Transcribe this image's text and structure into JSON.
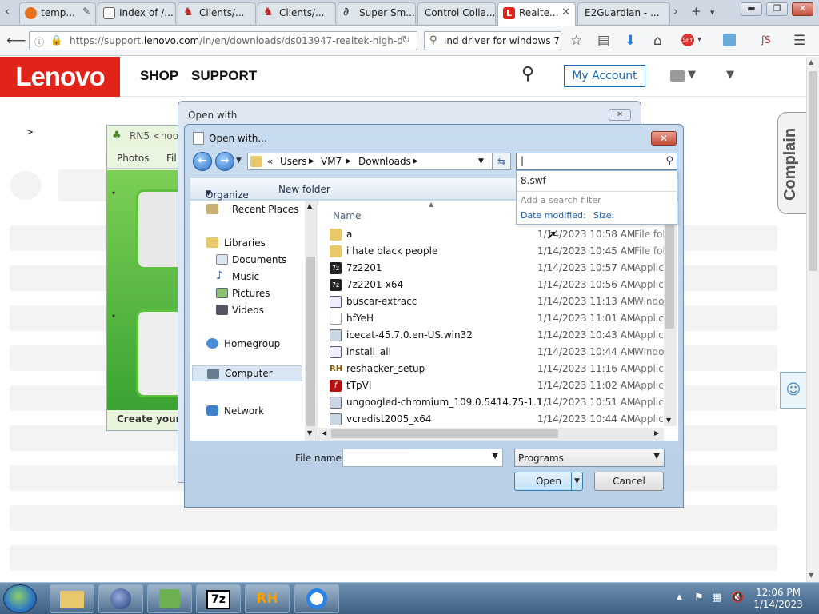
{
  "browser": {
    "tabs": [
      {
        "label": "temp...",
        "active": false
      },
      {
        "label": "Index of /...",
        "active": false
      },
      {
        "label": "Clients/...",
        "active": false
      },
      {
        "label": "Clients/...",
        "active": false
      },
      {
        "label": "Super Sm...",
        "active": false
      },
      {
        "label": "Control Colla...",
        "active": false
      },
      {
        "label": "Realte...",
        "active": true
      },
      {
        "label": "E2Guardian - ...",
        "active": false
      }
    ],
    "url_prefix": "https://support.",
    "url_domain": "lenovo.com",
    "url_rest": "/in/en/downloads/ds013947-realtek-high-d",
    "search_text": "ınd driver for windows 7 ›",
    "new_tab": "+"
  },
  "page": {
    "logo": "Lenovo",
    "nav_shop": "SHOP",
    "nav_support": "SUPPORT",
    "my_account": "My Account",
    "complain": "Complain",
    "breadcrumb_arrow": ">"
  },
  "rns_window": {
    "title": "RN5 <noo",
    "menu_photos": "Photos",
    "menu_file": "Fil",
    "footer": "Create your o"
  },
  "open_with_parent": {
    "title": "Open with"
  },
  "dialog": {
    "title": "Open with...",
    "breadcrumb": {
      "prefix": "«",
      "items": [
        "Users",
        "VM7",
        "Downloads"
      ]
    },
    "search_value": "",
    "search_dropdown": {
      "suggestion": "8.swf",
      "filter_hint": "Add a search filter",
      "filter_date": "Date modified:",
      "filter_size": "Size:"
    },
    "toolbar": {
      "organize": "Organize",
      "new_folder": "New folder"
    },
    "nav_pane": [
      {
        "label": "Recent Places"
      },
      {
        "label": "Libraries"
      },
      {
        "label": "Documents"
      },
      {
        "label": "Music"
      },
      {
        "label": "Pictures"
      },
      {
        "label": "Videos"
      },
      {
        "label": "Homegroup"
      },
      {
        "label": "Computer"
      },
      {
        "label": "Network"
      }
    ],
    "columns": {
      "name": "Name"
    },
    "files": [
      {
        "name": "a",
        "date": "1/14/2023 10:58 AM",
        "type": "File fol",
        "icon": "folder-icon"
      },
      {
        "name": "i hate black people",
        "date": "1/14/2023 10:45 AM",
        "type": "File fol",
        "icon": "folder-icon"
      },
      {
        "name": "7z2201",
        "date": "1/14/2023 10:57 AM",
        "type": "Applic",
        "icon": "7zip-icon"
      },
      {
        "name": "7z2201-x64",
        "date": "1/14/2023 10:56 AM",
        "type": "Applic",
        "icon": "7zip-icon"
      },
      {
        "name": "buscar-extracc",
        "date": "1/14/2023 11:13 AM",
        "type": "Windo",
        "icon": "script-icon"
      },
      {
        "name": "hfYeH",
        "date": "1/14/2023 11:01 AM",
        "type": "Applic",
        "icon": "app-icon"
      },
      {
        "name": "icecat-45.7.0.en-US.win32",
        "date": "1/14/2023 10:43 AM",
        "type": "Applic",
        "icon": "installer-icon"
      },
      {
        "name": "install_all",
        "date": "1/14/2023 10:44 AM",
        "type": "Windo",
        "icon": "script-icon"
      },
      {
        "name": "reshacker_setup",
        "date": "1/14/2023 11:16 AM",
        "type": "Applic",
        "icon": "rh-icon"
      },
      {
        "name": "tTpVI",
        "date": "1/14/2023 11:02 AM",
        "type": "Applic",
        "icon": "flash-icon"
      },
      {
        "name": "ungoogled-chromium_109.0.5414.75-1.1...",
        "date": "1/14/2023 10:51 AM",
        "type": "Applic",
        "icon": "installer-icon"
      },
      {
        "name": "vcredist2005_x64",
        "date": "1/14/2023 10:44 AM",
        "type": "Applic",
        "icon": "installer-icon"
      }
    ],
    "file_name_label": "File name:",
    "file_name_value": "",
    "file_type": "Programs",
    "open_button": "Open",
    "cancel_button": "Cancel"
  },
  "taskbar": {
    "buttons": [
      "explorer",
      "firefox",
      "network",
      "7z",
      "RH",
      "chrome"
    ],
    "label_7z": "7z",
    "label_rh": "RH",
    "time": "12:06 PM",
    "date": "1/14/2023"
  },
  "colors": {
    "lenovo_red": "#e2231a",
    "link_blue": "#1a6cb7",
    "accent_dialog": "#b9cfe6"
  }
}
